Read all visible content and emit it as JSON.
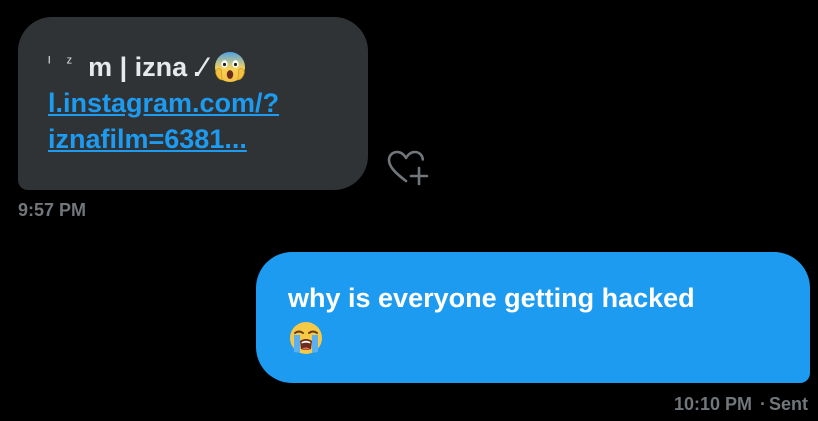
{
  "incoming": {
    "sender_prefix": "ᴵ ᶻ",
    "sender_name": "m | izna",
    "sender_suffix": ".⁄",
    "emoji_scream": "face-screaming-in-fear-emoji",
    "link_line1": "l.instagram.com/?",
    "link_line2": "iznafilm=6381...",
    "time": "9:57 PM"
  },
  "outgoing": {
    "text": "why is everyone getting hacked",
    "emoji_sob": "loudly-crying-face-emoji",
    "time": "10:10 PM",
    "separator": "·",
    "status": "Sent"
  },
  "icons": {
    "react": "heart-add-icon"
  },
  "colors": {
    "background": "#000000",
    "incoming_bubble": "#2f3336",
    "outgoing_bubble": "#1d9bf0",
    "link": "#1d9bf0",
    "meta_text": "#71767b"
  }
}
